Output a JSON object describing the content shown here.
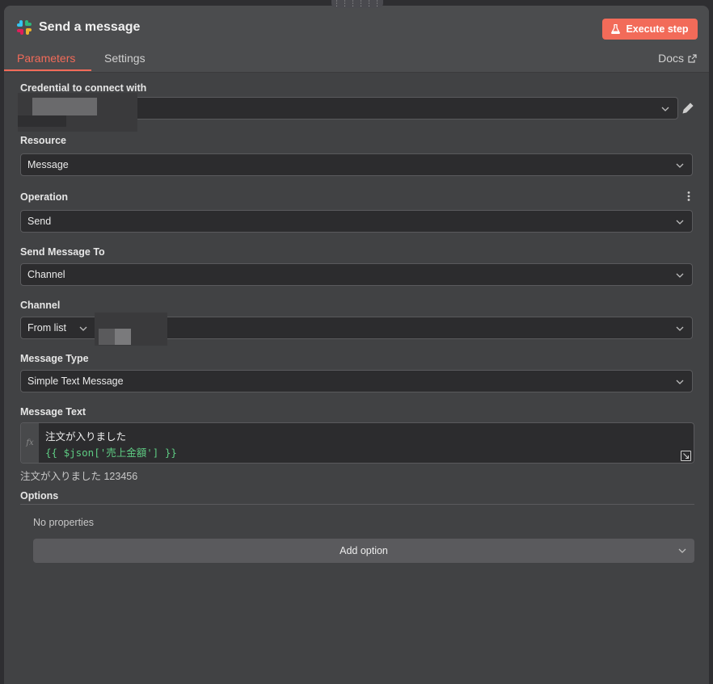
{
  "node": {
    "title": "Send a message",
    "execute_label": "Execute step"
  },
  "tabs": [
    {
      "label": "Parameters",
      "active": true
    },
    {
      "label": "Settings",
      "active": false
    }
  ],
  "docs_label": "Docs",
  "fields": {
    "credential": {
      "label": "Credential to connect with"
    },
    "resource": {
      "label": "Resource",
      "value": "Message"
    },
    "operation": {
      "label": "Operation",
      "value": "Send"
    },
    "send_to": {
      "label": "Send Message To",
      "value": "Channel"
    },
    "channel": {
      "label": "Channel",
      "mode": "From list"
    },
    "message_type": {
      "label": "Message Type",
      "value": "Simple Text Message"
    },
    "message_text": {
      "label": "Message Text",
      "line1": "注文が入りました",
      "line2": "{{ $json['売上金額'] }}",
      "preview": "注文が入りました 123456"
    }
  },
  "options": {
    "label": "Options",
    "empty_text": "No properties",
    "add_label": "Add option"
  },
  "colors": {
    "accent": "#f26b59",
    "panel": "#414244",
    "input_bg": "#2c2c2e",
    "expression_green": "#5ecb83"
  }
}
